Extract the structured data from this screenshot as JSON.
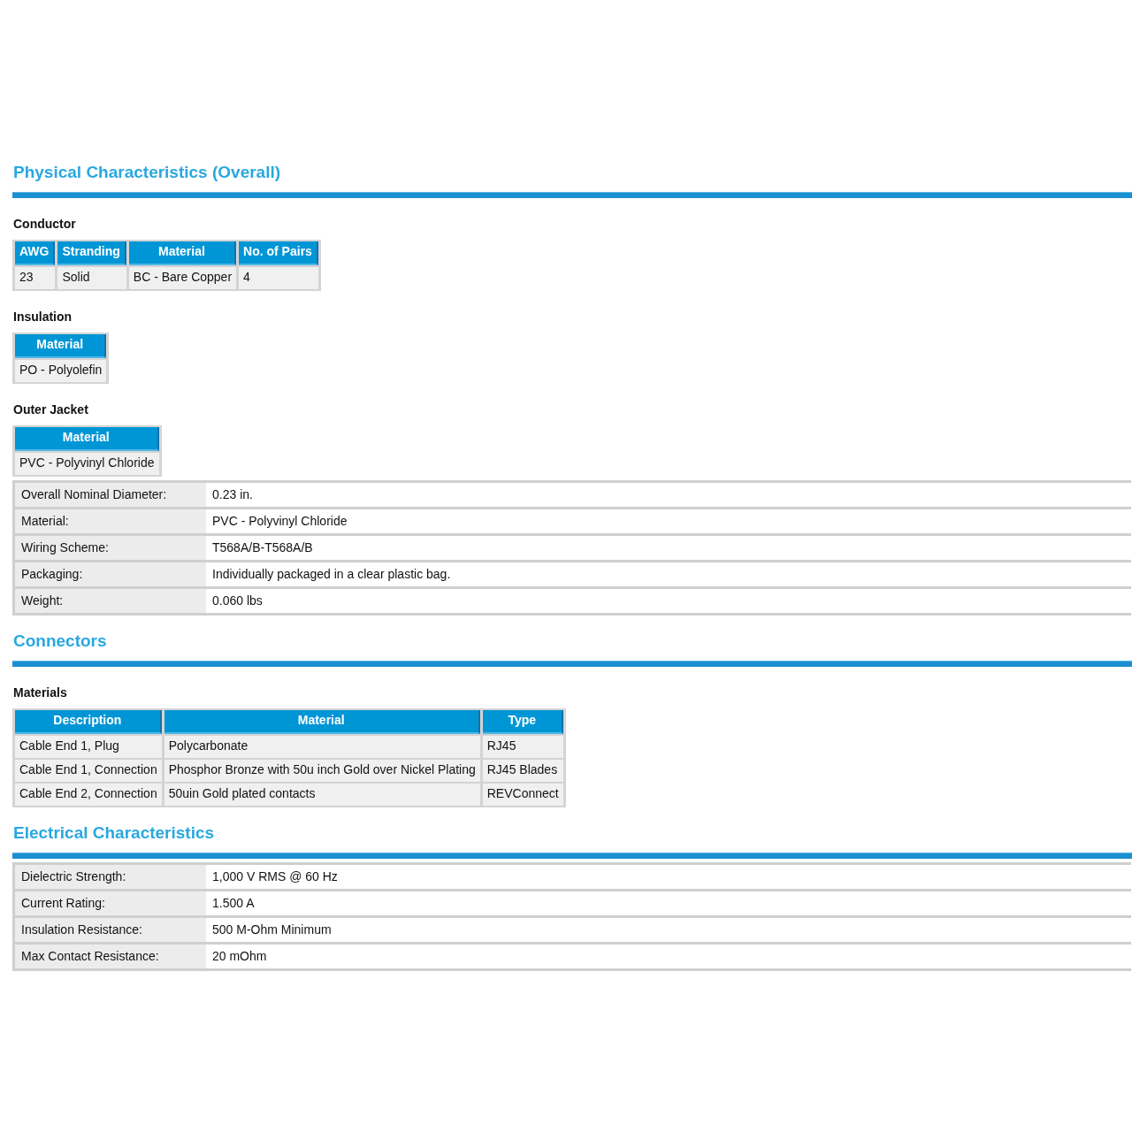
{
  "sections": [
    {
      "title": "Physical Characteristics (Overall)",
      "blocks": [
        {
          "kind": "table",
          "subtitle": "Conductor",
          "columns": [
            "AWG",
            "Stranding",
            "Material",
            "No. of Pairs"
          ],
          "rows": [
            [
              "23",
              "Solid",
              "BC - Bare Copper",
              "4"
            ]
          ]
        },
        {
          "kind": "table",
          "subtitle": "Insulation",
          "columns": [
            "Material"
          ],
          "rows": [
            [
              "PO - Polyolefin"
            ]
          ]
        },
        {
          "kind": "table",
          "subtitle": "Outer Jacket",
          "columns": [
            "Material"
          ],
          "rows": [
            [
              "PVC - Polyvinyl Chloride"
            ]
          ]
        },
        {
          "kind": "properties",
          "rows": [
            {
              "label": "Overall Nominal Diameter:",
              "value": "0.23 in."
            },
            {
              "label": "Material:",
              "value": "PVC - Polyvinyl Chloride"
            },
            {
              "label": "Wiring Scheme:",
              "value": "T568A/B-T568A/B"
            },
            {
              "label": "Packaging:",
              "value": "Individually packaged in a clear plastic bag."
            },
            {
              "label": "Weight:",
              "value": "0.060 lbs"
            }
          ]
        }
      ]
    },
    {
      "title": "Connectors",
      "blocks": [
        {
          "kind": "table",
          "subtitle": "Materials",
          "columns": [
            "Description",
            "Material",
            "Type"
          ],
          "rows": [
            [
              "Cable End 1, Plug",
              "Polycarbonate",
              "RJ45"
            ],
            [
              "Cable End 1, Connection",
              "Phosphor Bronze with 50u inch Gold over Nickel Plating",
              "RJ45 Blades"
            ],
            [
              "Cable End 2, Connection",
              "50uin Gold plated contacts",
              "REVConnect"
            ]
          ]
        }
      ]
    },
    {
      "title": "Electrical Characteristics",
      "blocks": [
        {
          "kind": "properties",
          "rows": [
            {
              "label": "Dielectric Strength:",
              "value": "1,000 V RMS @ 60 Hz"
            },
            {
              "label": "Current Rating:",
              "value": "1.500 A"
            },
            {
              "label": "Insulation Resistance:",
              "value": "500 M-Ohm Minimum"
            },
            {
              "label": "Max Contact Resistance:",
              "value": "20 mOhm"
            }
          ]
        }
      ]
    }
  ]
}
